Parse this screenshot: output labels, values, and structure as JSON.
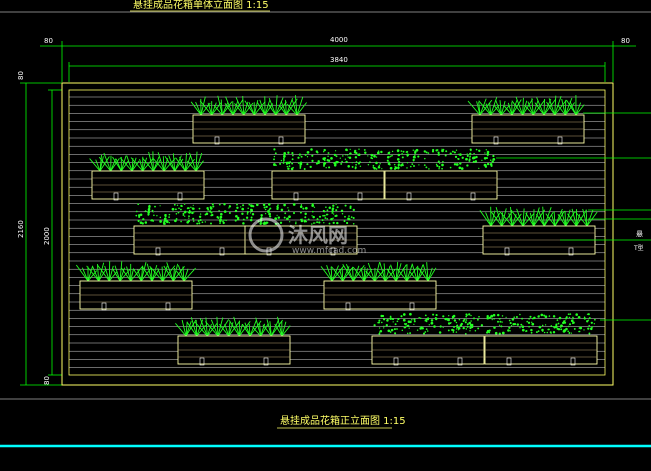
{
  "top_title": "悬挂成品花箱单体立面图  1:15",
  "bottom_title": "悬挂成品花箱正立面图  1:15",
  "dimensions": {
    "overall_width": "4000",
    "inner_width": "3840",
    "left_offset": "80",
    "right_offset": "80",
    "overall_height": "2160",
    "inner_height": "2000",
    "top_offset": "80",
    "bottom_offset": "80"
  },
  "side_notes": [
    "悬",
    "T型"
  ],
  "watermark": {
    "brand": "沐风网",
    "url": "www.mfcad.com"
  },
  "colors": {
    "background": "#000000",
    "frame": "#ffff66",
    "dim_line": "#00ff00",
    "plants": "#22ff22",
    "box": "#ffffaa",
    "bottom_bar": "#00ffff",
    "text": "#ffffff"
  }
}
